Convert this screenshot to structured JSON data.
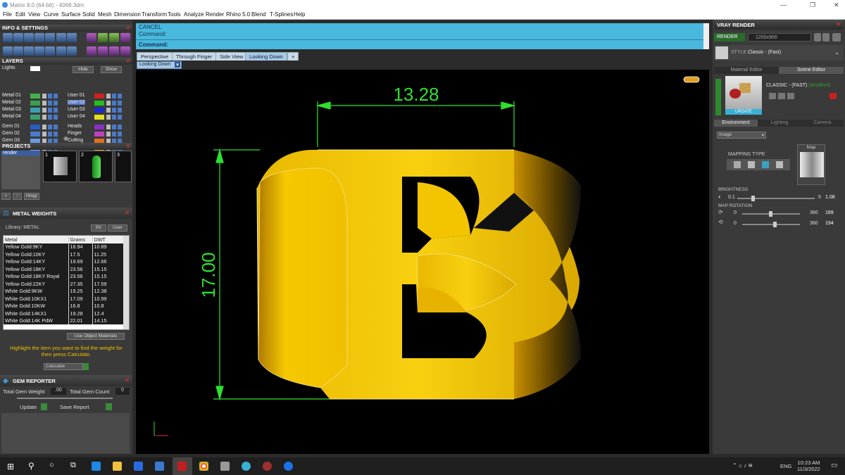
{
  "window": {
    "title": "Matrix 8.0 (64-bit) - 4068.3dm",
    "minimize": "—",
    "maximize": "❐",
    "close": "✕"
  },
  "menu": [
    "File",
    "Edit",
    "View",
    "Curve",
    "Surface",
    "Solid",
    "Mesh",
    "Dimension",
    "Transform",
    "Tools",
    "Analyze",
    "Render",
    "Rhino 5.0",
    "Blend",
    "T-Splines",
    "Help"
  ],
  "info_settings": {
    "title": "INFO & SETTINGS"
  },
  "layers": {
    "title": "LAYERS",
    "lights_label": "Lights",
    "hide_label": "Hide",
    "show_label": "Show",
    "left": [
      {
        "name": "Metal 01",
        "color": "#44b24c"
      },
      {
        "name": "Metal 02",
        "color": "#3aa050"
      },
      {
        "name": "Metal 03",
        "color": "#3aa0b0"
      },
      {
        "name": "Metal 04",
        "color": "#3aa070"
      },
      {
        "name": "Gem 01",
        "color": "#2a5cc0"
      },
      {
        "name": "Gem 02",
        "color": "#4a7ad0"
      },
      {
        "name": "Gem 03",
        "color": "#6a9ae0"
      },
      {
        "name": "Gem 04",
        "color": "#8aaae0"
      }
    ],
    "right": [
      {
        "name": "User 01",
        "color": "#d02020"
      },
      {
        "name": "User 02",
        "color": "#20c020"
      },
      {
        "name": "User 03",
        "color": "#1a2ad0"
      },
      {
        "name": "User 04",
        "color": "#e0e020"
      },
      {
        "name": "Heads",
        "color": "#8a30c0"
      },
      {
        "name": "Finger",
        "color": "#c040c0"
      },
      {
        "name": "Cutting",
        "color": "#e07020"
      },
      {
        "name": "Creation",
        "color": "#f0a030"
      }
    ]
  },
  "projects": {
    "title": "PROJECTS",
    "item": "render",
    "thumbs": [
      "1",
      "2",
      "3"
    ],
    "button_hmgr": "Hmgr"
  },
  "metal_weights": {
    "title": "METAL WEIGHTS",
    "library_label": "Library: METAL",
    "sv_label": "SV",
    "user_label": "User",
    "columns": [
      "Metal",
      "Grams",
      "DWT"
    ],
    "rows": [
      [
        "Yellow Gold:9KY",
        "16.94",
        "10.89"
      ],
      [
        "Yellow Gold:10KY",
        "17.5",
        "11.25"
      ],
      [
        "Yellow Gold:14KY",
        "19.69",
        "12.66"
      ],
      [
        "Yellow Gold:18KY",
        "23.56",
        "15.15"
      ],
      [
        "Yellow Gold:18KY Royal",
        "23.56",
        "15.15"
      ],
      [
        "Yellow Gold:22KY",
        "27.35",
        "17.59"
      ],
      [
        "White Gold:9KW",
        "19.25",
        "12.38"
      ],
      [
        "White Gold:10KX1",
        "17.09",
        "10.99"
      ],
      [
        "White Gold:10KW",
        "16.8",
        "10.8"
      ],
      [
        "White Gold:14KX1",
        "19.28",
        "12.4"
      ],
      [
        "White Gold:14K PdW",
        "22.01",
        "14.15"
      ]
    ],
    "use_object_materials": "Use Object Materials",
    "hint": "Highlight the item you want to find the weight for then press Calculate.",
    "calculate": "Calculate"
  },
  "gem_reporter": {
    "title": "GEM REPORTER",
    "total_weight_label": "Total Gem Weight",
    "total_weight_value": ".00",
    "total_count_label": "Total Gem Count",
    "total_count_value": "0",
    "update": "Update",
    "save_report": "Save Report"
  },
  "command": {
    "line1": "CANCEL",
    "line2": "Command:",
    "prompt": "Command:"
  },
  "view_tabs": [
    "Perspective",
    "Through Finger",
    "Side View",
    "Looking Down"
  ],
  "view_active": "Looking Down",
  "view_label": "Looking Down",
  "dimensions": {
    "width": "13.28",
    "height": "17.00"
  },
  "vray": {
    "title": "VRAY RENDER",
    "render": "RENDER",
    "resolution": "1200x900",
    "style_label": "STYLE",
    "style_value": "Classic - (Fast)",
    "tabs": [
      "Material Editor",
      "Scene Editor"
    ],
    "preset_name": "CLASSIC - (FAST)",
    "preset_state": "(Modified)",
    "update": "UPDATE",
    "subtabs": [
      "Environment",
      "Lighting",
      "Camera"
    ],
    "env_type": "Image",
    "mapping_type": "MAPPING TYPE",
    "map_label": "Map",
    "brightness_label": "BRIGHTNESS",
    "brightness_min": "0.1",
    "brightness_max": "5",
    "brightness_value": "1.08",
    "map_rotation_label": "MAP ROTATION",
    "rot1_min": "0",
    "rot1_max": "360",
    "rot1_value": "169",
    "rot2_min": "0",
    "rot2_max": "360",
    "rot2_value": "194"
  },
  "taskbar": {
    "time": "10:23 AM",
    "date": "11/3/2022",
    "lang": "ENG"
  }
}
